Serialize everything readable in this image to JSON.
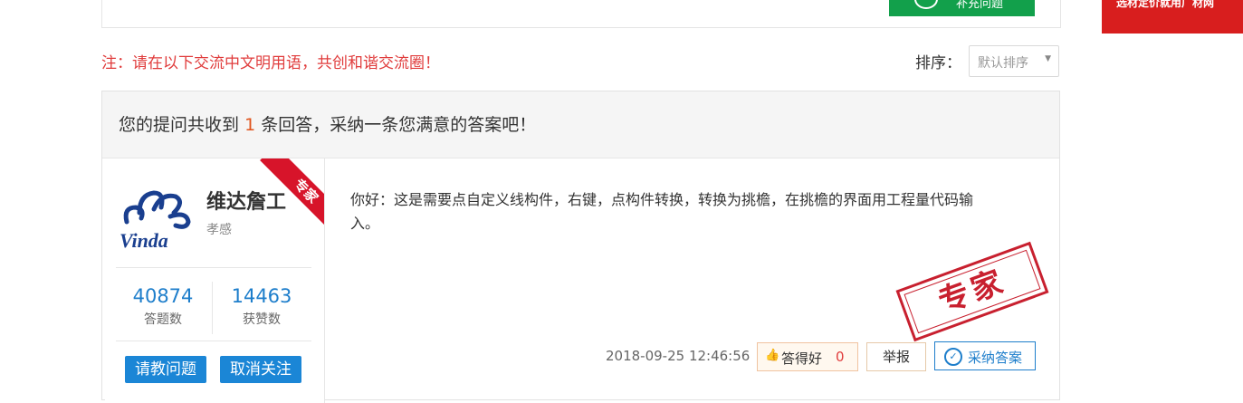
{
  "top": {
    "supplement_label": "补充问题",
    "ad_text": "选材定价就用广材网"
  },
  "notice": "注：请在以下交流中文明用语，共创和谐交流圈！",
  "sort": {
    "label": "排序：",
    "selected": "默认排序"
  },
  "header": {
    "prefix": "您的提问共收到",
    "count": "1",
    "suffix": "条回答，采纳一条您满意的答案吧！"
  },
  "profile": {
    "name": "维达詹工",
    "location": "孝感",
    "badge": "专家",
    "logo_text": "Vinda",
    "stats": [
      {
        "value": "40874",
        "label": "答题数"
      },
      {
        "value": "14463",
        "label": "获赞数"
      }
    ],
    "ask_button": "请教问题",
    "unfollow_button": "取消关注"
  },
  "answer": {
    "text": "你好：这是需要点自定义线构件，右键，点构件转换，转换为挑檐，在挑檐的界面用工程量代码输入。",
    "stamp": "专家",
    "timestamp": "2018-09-25 12:46:56",
    "good_label": "答得好",
    "good_count": "0",
    "report_label": "举报",
    "accept_label": "采纳答案"
  },
  "colors": {
    "accent": "#1e7ecb",
    "notice": "#e03c3c",
    "badge": "#d7142a",
    "green": "#12a04b"
  }
}
